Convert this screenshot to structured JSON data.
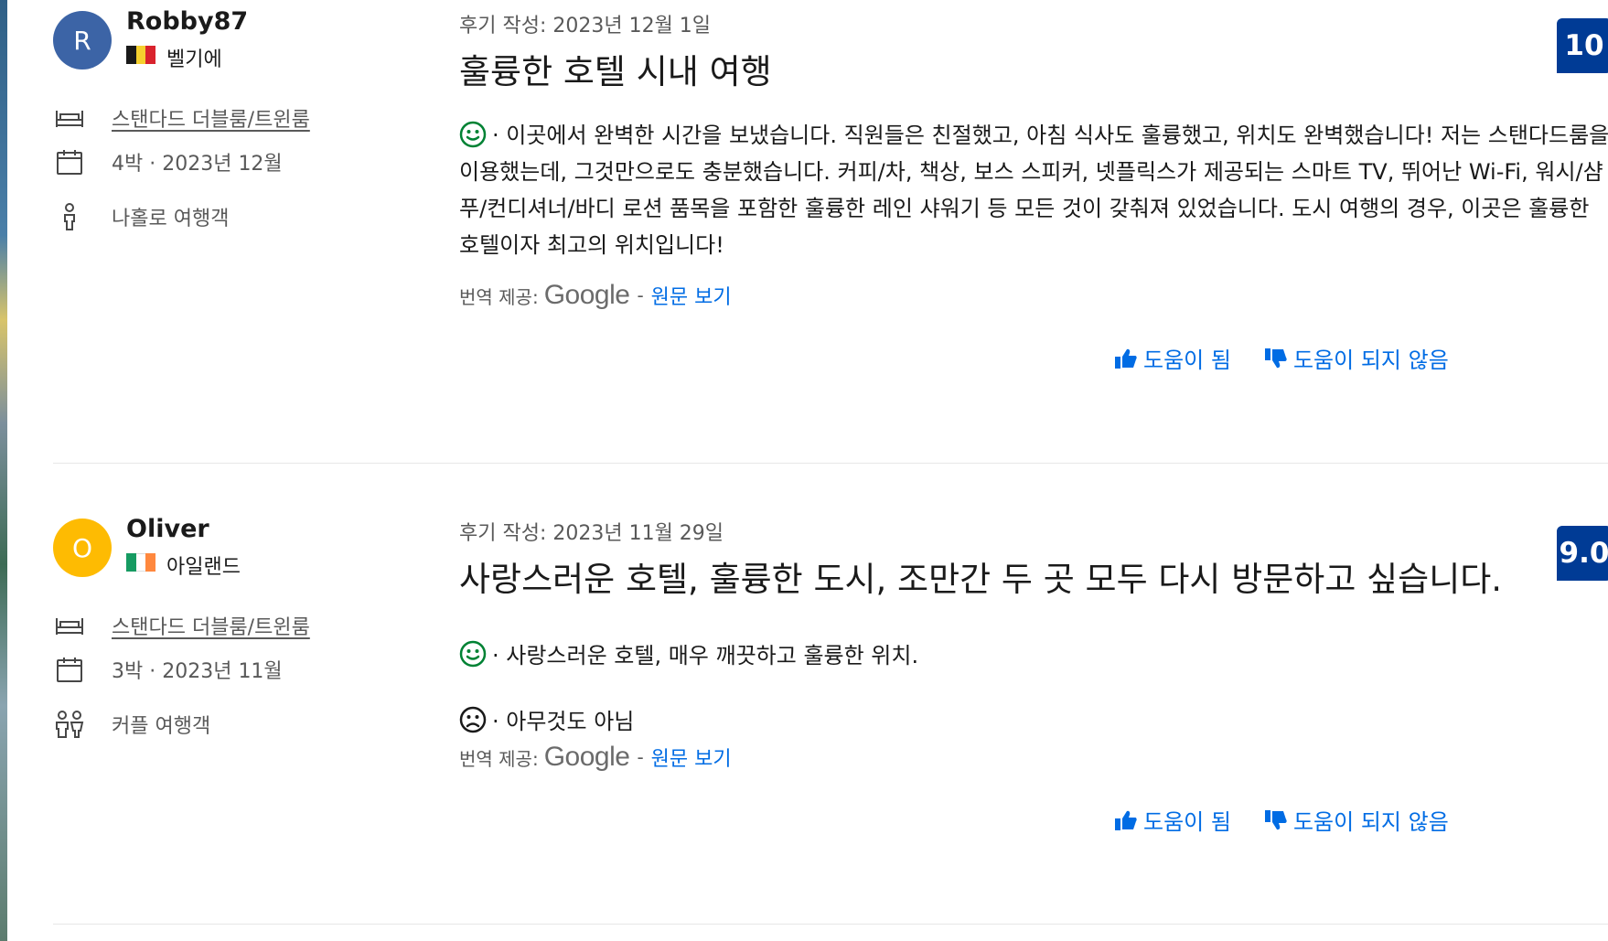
{
  "reviews": [
    {
      "avatar_letter": "R",
      "avatar_color": "#3c64a6",
      "name": "Robby87",
      "country": "벨기에",
      "flag_colors": [
        "#1a1a1a",
        "#f5d02e",
        "#d9232d"
      ],
      "room": "스탠다드 더블룸/트윈룸",
      "stay": "4박 · 2023년 12월",
      "traveler_type": "나홀로 여행객",
      "traveler_icon": "solo-traveler-icon",
      "date": "후기 작성: 2023년 12월 1일",
      "title": "훌륭한 호텔 시내 여행",
      "score": "10",
      "positive": "· 이곳에서 완벽한 시간을 보냈습니다. 직원들은 친절했고, 아침 식사도 훌륭했고, 위치도 완벽했습니다! 저는 스탠다드룸을 이용했는데, 그것만으로도 충분했습니다. 커피/차, 책상, 보스 스피커, 넷플릭스가 제공되는 스마트 TV, 뛰어난 Wi-Fi, 워시/샴푸/컨디셔너/바디 로션 품목을 포함한 훌륭한 레인 샤워기 등 모든 것이 갖춰져 있었습니다. 도시 여행의 경우, 이곳은 훌륭한 호텔이자 최고의 위치입니다!",
      "negative": null,
      "translation_label": "번역 제공:",
      "translation_provider": "Google",
      "translation_sep": "-",
      "original_link": "원문 보기",
      "helpful": "도움이 됨",
      "not_helpful": "도움이 되지 않음"
    },
    {
      "avatar_letter": "O",
      "avatar_color": "#febb02",
      "name": "Oliver",
      "country": "아일랜드",
      "flag_colors": [
        "#169b62",
        "#ffffff",
        "#ff883e"
      ],
      "room": "스탠다드 더블룸/트윈룸",
      "stay": "3박 · 2023년 11월",
      "traveler_type": "커플 여행객",
      "traveler_icon": "couple-traveler-icon",
      "date": "후기 작성: 2023년 11월 29일",
      "title": "사랑스러운 호텔, 훌륭한 도시, 조만간 두 곳 모두 다시 방문하고 싶습니다.",
      "score": "9.0",
      "positive": "· 사랑스러운 호텔, 매우 깨끗하고 훌륭한 위치.",
      "negative": "· 아무것도 아님",
      "translation_label": "번역 제공:",
      "translation_provider": "Google",
      "translation_sep": "-",
      "original_link": "원문 보기",
      "helpful": "도움이 됨",
      "not_helpful": "도움이 되지 않음"
    }
  ],
  "colors": {
    "link": "#006ce4",
    "score_badge": "#003b95",
    "positive_face": "#008234",
    "muted_text": "#595959"
  }
}
